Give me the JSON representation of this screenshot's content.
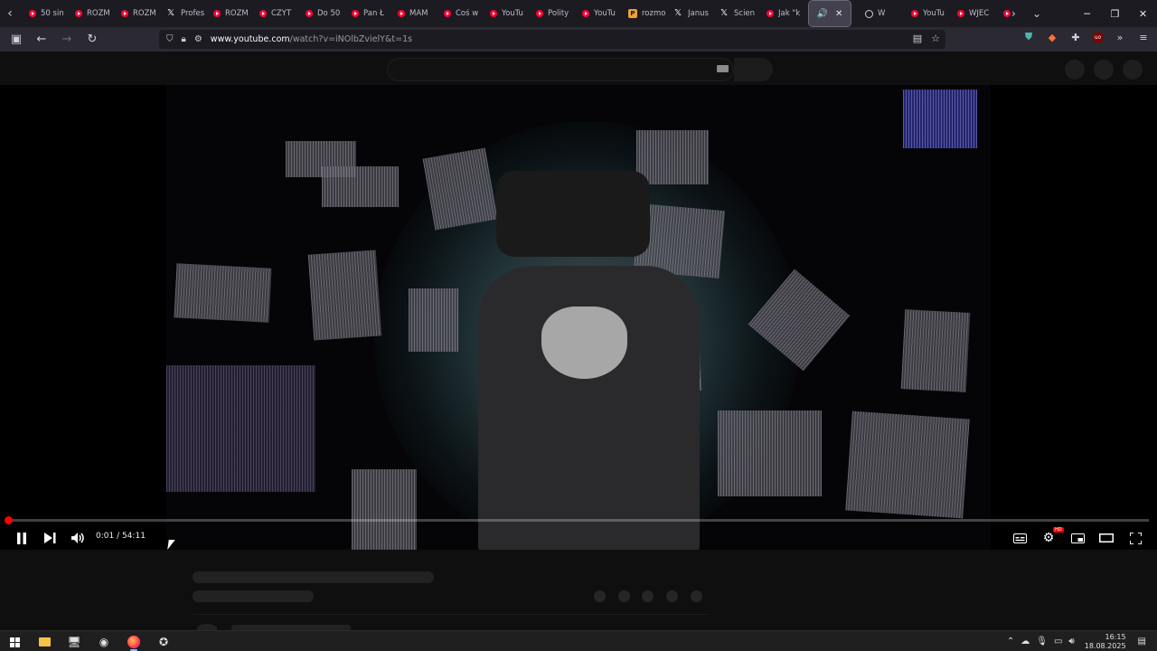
{
  "browser": {
    "tabs": [
      {
        "label": "50 sin",
        "icon": "youtube-icon"
      },
      {
        "label": "ROZM",
        "icon": "youtube-icon"
      },
      {
        "label": "ROZM",
        "icon": "youtube-icon"
      },
      {
        "label": "Profes",
        "icon": "x-icon"
      },
      {
        "label": "ROZM",
        "icon": "youtube-icon"
      },
      {
        "label": "CZYT",
        "icon": "youtube-icon"
      },
      {
        "label": "Do 50",
        "icon": "youtube-icon"
      },
      {
        "label": "Pan Ł",
        "icon": "youtube-icon"
      },
      {
        "label": "MAM",
        "icon": "youtube-icon"
      },
      {
        "label": "Coś w",
        "icon": "youtube-icon"
      },
      {
        "label": "YouTu",
        "icon": "youtube-icon"
      },
      {
        "label": "Polity",
        "icon": "youtube-icon"
      },
      {
        "label": "YouTu",
        "icon": "youtube-icon"
      },
      {
        "label": "rozmo",
        "icon": "p-icon"
      },
      {
        "label": "Janus",
        "icon": "x-icon"
      },
      {
        "label": "Scien",
        "icon": "x-icon"
      },
      {
        "label": "Jak \"k",
        "icon": "youtube-icon"
      }
    ],
    "active_tab": {
      "speaker": "🔊",
      "close": "✕"
    },
    "tabs_after": [
      {
        "label": "W",
        "icon": "globe-icon"
      },
      {
        "label": "YouTu",
        "icon": "youtube-icon"
      },
      {
        "label": "WJEC",
        "icon": "youtube-icon"
      },
      {
        "label": "",
        "icon": "youtube-icon"
      }
    ],
    "url_host": "www.youtube.com",
    "url_path": "/watch?v=iNOlbZvielY&t=1s"
  },
  "player": {
    "current_time": "0:01",
    "separator": " / ",
    "duration": "54:11",
    "progress": 0.0003,
    "hd_badge": "HD"
  },
  "taskbar": {
    "time": "16:15",
    "date": "18.08.2025"
  },
  "colors": {
    "accent_red": "#ff0000",
    "browser_chrome": "#1c1b22",
    "page_bg": "#0f0f0f"
  }
}
